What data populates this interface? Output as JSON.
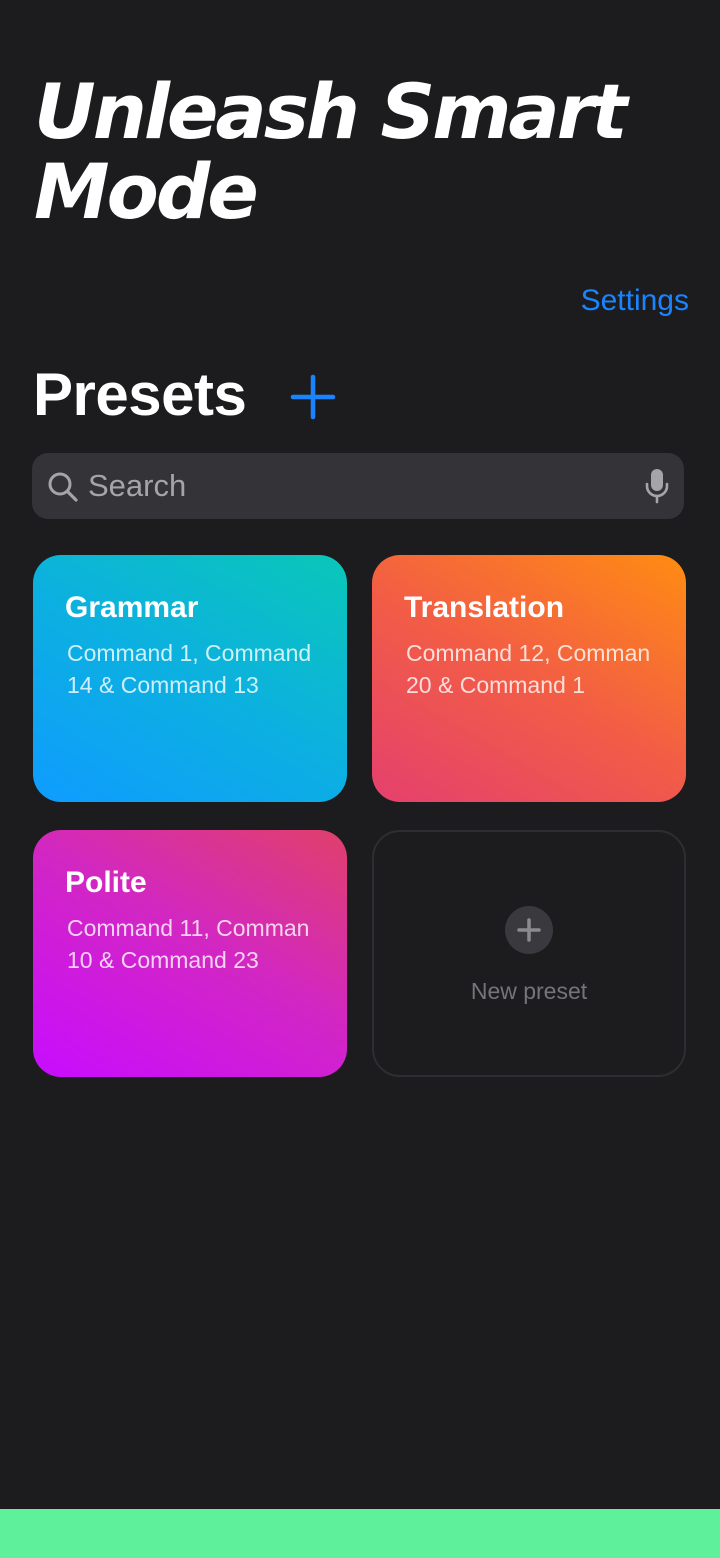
{
  "headline": "Unleash Smart Mode",
  "settings_label": "Settings",
  "presets": {
    "title": "Presets",
    "add_icon": "plus-icon"
  },
  "search": {
    "placeholder": "Search",
    "value": "",
    "left_icon": "search-icon",
    "right_icon": "microphone-icon"
  },
  "cards": [
    {
      "title": "Grammar",
      "description": "Command 1, Command 14 & Command 13"
    },
    {
      "title": "Translation",
      "description": "Command 12, Comman 20 & Command 1"
    },
    {
      "title": "Polite",
      "description": "Command 11, Comman 10 & Command 23"
    }
  ],
  "new_preset": {
    "label": "New preset",
    "icon": "plus-circle-icon"
  },
  "colors": {
    "background": "#1c1c1e",
    "accent": "#1a84ff",
    "grammar_gradient": [
      "#0f9cff",
      "#0ac7b8"
    ],
    "translation_gradient": [
      "#e5406e",
      "#ff8c12"
    ],
    "polite_gradient": [
      "#c80cff",
      "#e0406a"
    ],
    "bottom_strip": "#5ef09a"
  }
}
